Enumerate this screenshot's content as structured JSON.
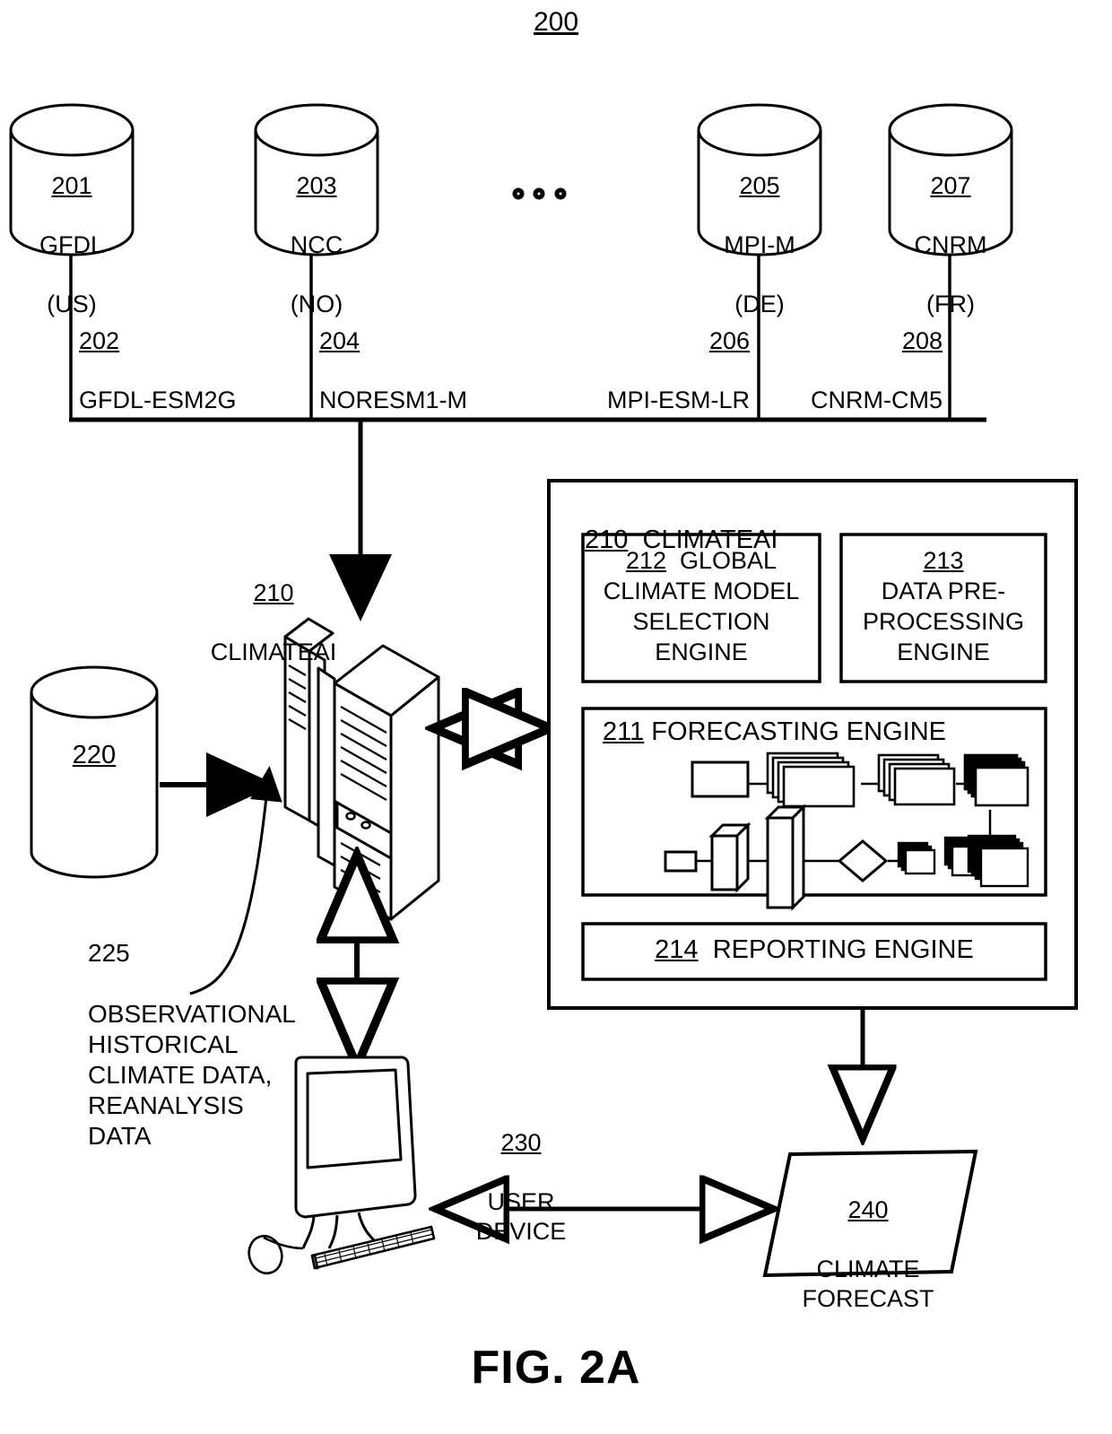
{
  "figure": {
    "number_top": "200",
    "caption": "FIG. 2A"
  },
  "sources": [
    {
      "ref": "201",
      "name": "GFDL",
      "country": "(US)",
      "model_ref": "202",
      "model": "GFDL-ESM2G"
    },
    {
      "ref": "203",
      "name": "NCC",
      "country": "(NO)",
      "model_ref": "204",
      "model": "NORESM1-M"
    },
    {
      "ref": "205",
      "name": "MPI-M",
      "country": "(DE)",
      "model_ref": "206",
      "model": "MPI-ESM-LR"
    },
    {
      "ref": "207",
      "name": "CNRM",
      "country": "(FR)",
      "model_ref": "208",
      "model": "CNRM-CM5"
    }
  ],
  "ellipsis": "∘ ∘ ∘",
  "server": {
    "ref": "210",
    "label": "CLIMATEAI"
  },
  "observational_db": {
    "ref": "220"
  },
  "observational_note": {
    "ref": "225",
    "text": "OBSERVATIONAL\nHISTORICAL\nCLIMATE DATA,\nREANALYSIS\nDATA"
  },
  "climateai_box": {
    "ref": "210",
    "title": "CLIMATEAI",
    "modules": [
      {
        "ref": "212",
        "label": "GLOBAL\nCLIMATE MODEL\nSELECTION\nENGINE",
        "first_line_inline": true
      },
      {
        "ref": "213",
        "label": "DATA PRE-\nPROCESSING\nENGINE",
        "first_line_inline": false
      }
    ],
    "forecasting_engine": {
      "ref": "211",
      "label": "FORECASTING ENGINE"
    },
    "reporting_engine": {
      "ref": "214",
      "label": "REPORTING ENGINE"
    }
  },
  "user_device": {
    "ref": "230",
    "label": "USER\nDEVICE"
  },
  "climate_forecast": {
    "ref": "240",
    "label": "CLIMATE\nFORECAST"
  },
  "colors": {
    "ink": "#000000",
    "paper": "#ffffff"
  }
}
